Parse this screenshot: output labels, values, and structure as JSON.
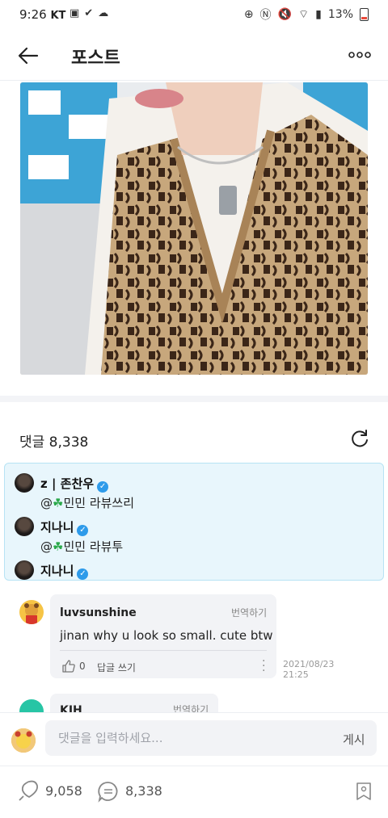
{
  "status_bar": {
    "time": "9:26",
    "carrier": "KT",
    "battery": "13%"
  },
  "header": {
    "title": "포스트",
    "back_icon": "arrow-left-icon",
    "more_icon": "more-dots-icon"
  },
  "post": {
    "image_alt": "photo"
  },
  "comments_section": {
    "count_label": "댓글 8,338",
    "refresh_icon": "refresh-icon"
  },
  "pinned": [
    {
      "name": "z | 존찬우",
      "text_prefix": "@",
      "text_name": "민민",
      "text_rest": " 라뷰쓰리"
    },
    {
      "name": "지나니",
      "text_prefix": "@",
      "text_name": "민민",
      "text_rest": " 라뷰투"
    },
    {
      "name": "지나니",
      "text_prefix": "",
      "text_name": "",
      "text_rest": ""
    }
  ],
  "comment": {
    "user": "luvsunshine",
    "translate": "번역하기",
    "text": "jinan why u look so small. cute btw",
    "likes": "0",
    "reply": "답글 쓰기",
    "date_line1": "2021/08/23",
    "date_line2": "21:25"
  },
  "comment2": {
    "user": "KJH",
    "translate": "번역하기"
  },
  "composer": {
    "placeholder": "댓글을 입력하세요...",
    "post_label": "게시"
  },
  "bottom_bar": {
    "likes": "9,058",
    "comments": "8,338"
  },
  "colors": {
    "pinned_bg": "#e8f6fc",
    "verified": "#2e9bea"
  }
}
